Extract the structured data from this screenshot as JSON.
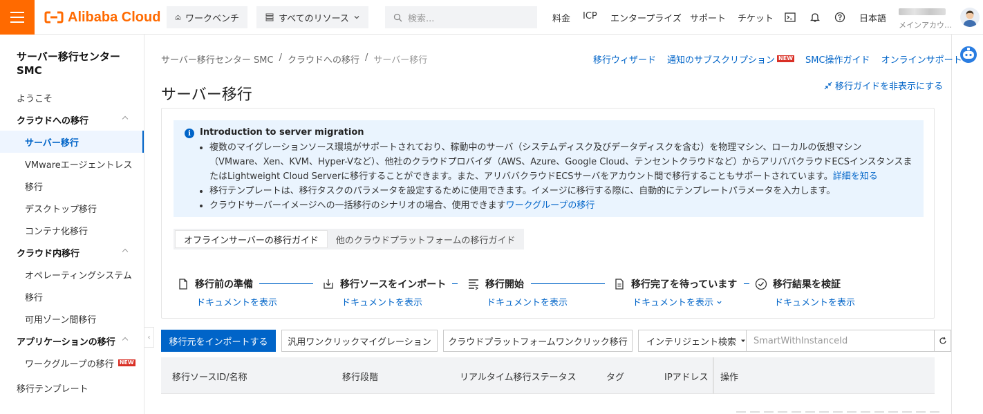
{
  "topbar": {
    "logo_text": "Alibaba Cloud",
    "workbench": "ワークベンチ",
    "all_resources": "すべてのリソース",
    "search_placeholder": "検索...",
    "links": [
      "料金",
      "ICP",
      "エンタープライズ",
      "サポート",
      "チケット"
    ],
    "language": "日本語",
    "account_sub": "メインアカウ…",
    "accent_color": "#ff6a00"
  },
  "sidebar": {
    "title": "サーバー移行センター SMC",
    "items": [
      {
        "label": "ようこそ"
      },
      {
        "label": "クラウドへの移行"
      },
      {
        "label": "サーバー移行"
      },
      {
        "label": "VMwareエージェントレス"
      },
      {
        "label": "移行"
      },
      {
        "label": "デスクトップ移行"
      },
      {
        "label": "コンテナ化移行"
      },
      {
        "label": "クラウド内移行"
      },
      {
        "label": "オペレーティングシステム"
      },
      {
        "label": "移行"
      },
      {
        "label": "可用ゾーン間移行"
      },
      {
        "label": "アプリケーションの移行"
      },
      {
        "label": "ワークグループの移行"
      },
      {
        "label": "移行テンプレート"
      }
    ],
    "new_badge": "NEW"
  },
  "breadcrumb": [
    "サーバー移行センター SMC",
    "/",
    "クラウドへの移行",
    "/",
    "サーバー移行"
  ],
  "page_links": {
    "wizard": "移行ウィザード",
    "subscription": "通知のサブスクリプション",
    "new_badge": "NEW",
    "guide": "SMC操作ガイド",
    "support": "オンラインサポート"
  },
  "page_title": "サーバー移行",
  "hide_guide": "移行ガイドを非表示にする",
  "intro": {
    "title": "Introduction to server migration",
    "bullet1": "複数のマイグレーションソース環境がサポートされており、稼動中のサーバ（システムディスク及びデータディスクを含む）を物理マシン、ローカルの仮想マシン（VMware、Xen、KVM、Hyper-Vなど）、他社のクラウドプロバイダ（AWS、Azure、Google Cloud、テンセントクラウドなど）からアリババクラウドECSインスタンスまたはLightweight Cloud Serverに移行することができます。また、アリババクラウドECSサーバをアカウント間で移行することもサポートされています。",
    "bullet1_link": "詳細を知る",
    "bullet2": "移行テンプレートは、移行タスクのパラメータを設定するために使用できます。イメージに移行する際に、自動的にテンプレートパラメータを入力します。",
    "bullet3": "クラウドサーバーイメージへの一括移行のシナリオの場合、使用できます",
    "bullet3_link": "ワークグループの移行"
  },
  "guide_tabs": [
    "オフラインサーバーの移行ガイド",
    "他のクラウドプラットフォームの移行ガイド"
  ],
  "steps": [
    {
      "title": "移行前の準備",
      "link": "ドキュメントを表示"
    },
    {
      "title": "移行ソースをインポート",
      "link": "ドキュメントを表示"
    },
    {
      "title": "移行開始",
      "link": "ドキュメントを表示"
    },
    {
      "title": "移行完了を待っています",
      "link": "ドキュメントを表示"
    },
    {
      "title": "移行結果を検証",
      "link": "ドキュメントを表示"
    }
  ],
  "toolbar": {
    "import_btn": "移行元をインポートする",
    "one_click_btn": "汎用ワンクリックマイグレーション",
    "cloud_one_click_btn": "クラウドプラットフォームワンクリック移行",
    "search_select": "インテリジェント検索",
    "search_placeholder": "SmartWithInstanceId"
  },
  "table": {
    "columns": [
      "移行ソースID/名称",
      "移行段階",
      "リアルタイム移行ステータス",
      "タグ",
      "IPアドレス",
      "操作"
    ]
  }
}
